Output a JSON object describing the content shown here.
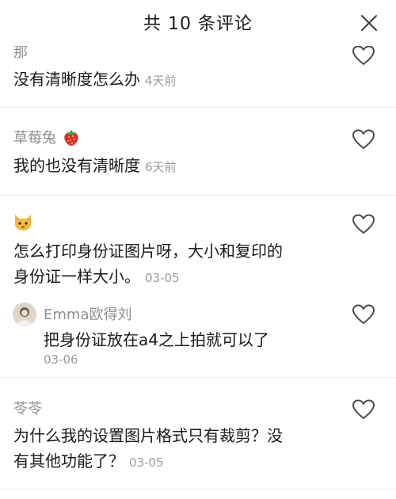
{
  "header": {
    "title": "共 10 条评论",
    "close_icon": "close-icon"
  },
  "comments": [
    {
      "author": "那",
      "text": "没有清晰度怎么办",
      "time": "4天前",
      "like_icon": "heart-outline-icon"
    },
    {
      "author": "草莓兔",
      "author_emoji": "strawberry-icon",
      "text": "我的也没有清晰度",
      "time": "6天前",
      "like_icon": "heart-outline-icon"
    },
    {
      "author_emoji": "cat-face-icon",
      "text_line1": "怎么打印身份证图片呀，大小和复印的",
      "text_line2": "身份证一样大小。",
      "time": "03-05",
      "like_icon": "heart-outline-icon",
      "reply": {
        "author": "Emma欧得刘",
        "text": "把身份证放在a4之上拍就可以了",
        "time": "03-06",
        "like_icon": "heart-outline-icon"
      }
    },
    {
      "author": "苓苓",
      "text_line1": "为什么我的设置图片格式只有裁剪？没",
      "text_line2": "有其他功能了？",
      "time": "03-05",
      "like_icon": "heart-outline-icon"
    }
  ],
  "colors": {
    "text": "#1a1a1a",
    "muted": "#8f8f8f",
    "separator": "#ececec"
  }
}
